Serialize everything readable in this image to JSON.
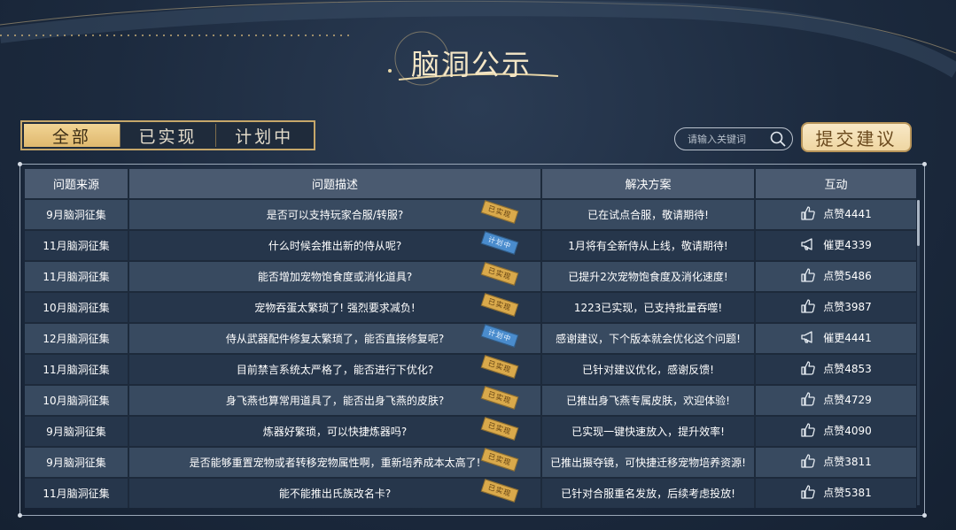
{
  "title": "脑洞公示",
  "tabs": [
    {
      "label": "全部",
      "active": true
    },
    {
      "label": "已实现",
      "active": false
    },
    {
      "label": "计划中",
      "active": false
    }
  ],
  "search": {
    "placeholder": "请输入关键词",
    "icon": "search-icon"
  },
  "submit_button": "提交建议",
  "table": {
    "headers": [
      "问题来源",
      "问题描述",
      "解决方案",
      "互动"
    ],
    "rows": [
      {
        "source": "9月脑洞征集",
        "desc": "是否可以支持玩家合服/转服?",
        "status": "已实现",
        "solution": "已在试点合服，敬请期待!",
        "action_icon": "thumbs-up-icon",
        "action": "点赞4441"
      },
      {
        "source": "11月脑洞征集",
        "desc": "什么时候会推出新的侍从呢?",
        "status": "计划中",
        "solution": "1月将有全新侍从上线，敬请期待!",
        "action_icon": "megaphone-icon",
        "action": "催更4339"
      },
      {
        "source": "11月脑洞征集",
        "desc": "能否增加宠物饱食度或消化道具?",
        "status": "已实现",
        "solution": "已提升2次宠物饱食度及消化速度!",
        "action_icon": "thumbs-up-icon",
        "action": "点赞5486"
      },
      {
        "source": "10月脑洞征集",
        "desc": "宠物吞蛋太繁琐了! 强烈要求减负!",
        "status": "已实现",
        "solution": "1223已实现，已支持批量吞噬!",
        "action_icon": "thumbs-up-icon",
        "action": "点赞3987"
      },
      {
        "source": "12月脑洞征集",
        "desc": "侍从武器配件修复太繁琐了，能否直接修复呢?",
        "status": "计划中",
        "solution": "感谢建议，下个版本就会优化这个问题!",
        "action_icon": "megaphone-icon",
        "action": "催更4441"
      },
      {
        "source": "11月脑洞征集",
        "desc": "目前禁言系统太严格了，能否进行下优化?",
        "status": "已实现",
        "solution": "已针对建议优化，感谢反馈!",
        "action_icon": "thumbs-up-icon",
        "action": "点赞4853"
      },
      {
        "source": "10月脑洞征集",
        "desc": "身飞燕也算常用道具了，能否出身飞燕的皮肤?",
        "status": "已实现",
        "solution": "已推出身飞燕专属皮肤，欢迎体验!",
        "action_icon": "thumbs-up-icon",
        "action": "点赞4729"
      },
      {
        "source": "9月脑洞征集",
        "desc": "炼器好繁琐，可以快捷炼器吗?",
        "status": "已实现",
        "solution": "已实现一键快速放入，提升效率!",
        "action_icon": "thumbs-up-icon",
        "action": "点赞4090"
      },
      {
        "source": "9月脑洞征集",
        "desc": "是否能够重置宠物或者转移宠物属性啊，重新培养成本太高了!",
        "status": "已实现",
        "solution": "已推出摄夺镜，可快捷迁移宠物培养资源!",
        "action_icon": "thumbs-up-icon",
        "action": "点赞3811"
      },
      {
        "source": "11月脑洞征集",
        "desc": "能不能推出氏族改名卡?",
        "status": "已实现",
        "solution": "已针对合服重名发放，后续考虑投放!",
        "action_icon": "thumbs-up-icon",
        "action": "点赞5381"
      }
    ]
  },
  "colors": {
    "accent_gold": "#dfb86e",
    "done_stamp": "#d9a94b",
    "plan_stamp": "#4a8ccd",
    "header_bg": "#4a5a70"
  }
}
